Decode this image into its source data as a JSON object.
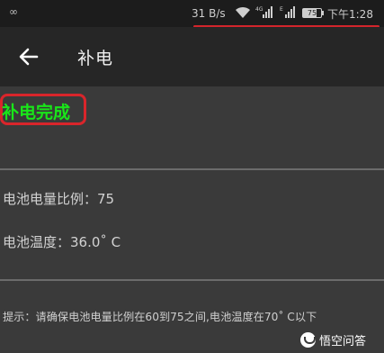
{
  "status_bar": {
    "left_icon": "∞",
    "net_speed": "31 B/s",
    "signal1_label": "4G",
    "signal2_label": "E",
    "battery": "75",
    "time": "下午1:28"
  },
  "app_bar": {
    "back_icon": "arrow-left-icon",
    "title": "补电"
  },
  "result": {
    "text": "补电完成",
    "color": "#19e619"
  },
  "info": {
    "battery_ratio": "电池电量比例：75",
    "battery_temp": "电池温度：36.0˚ C"
  },
  "tip": "提示：请确保电池电量比例在60到75之间,电池温度在70˚ C以下",
  "watermark": "悟空问答",
  "colors": {
    "highlight_red": "#d3252c",
    "background": "#3a3a3a",
    "app_bar": "#262626"
  }
}
